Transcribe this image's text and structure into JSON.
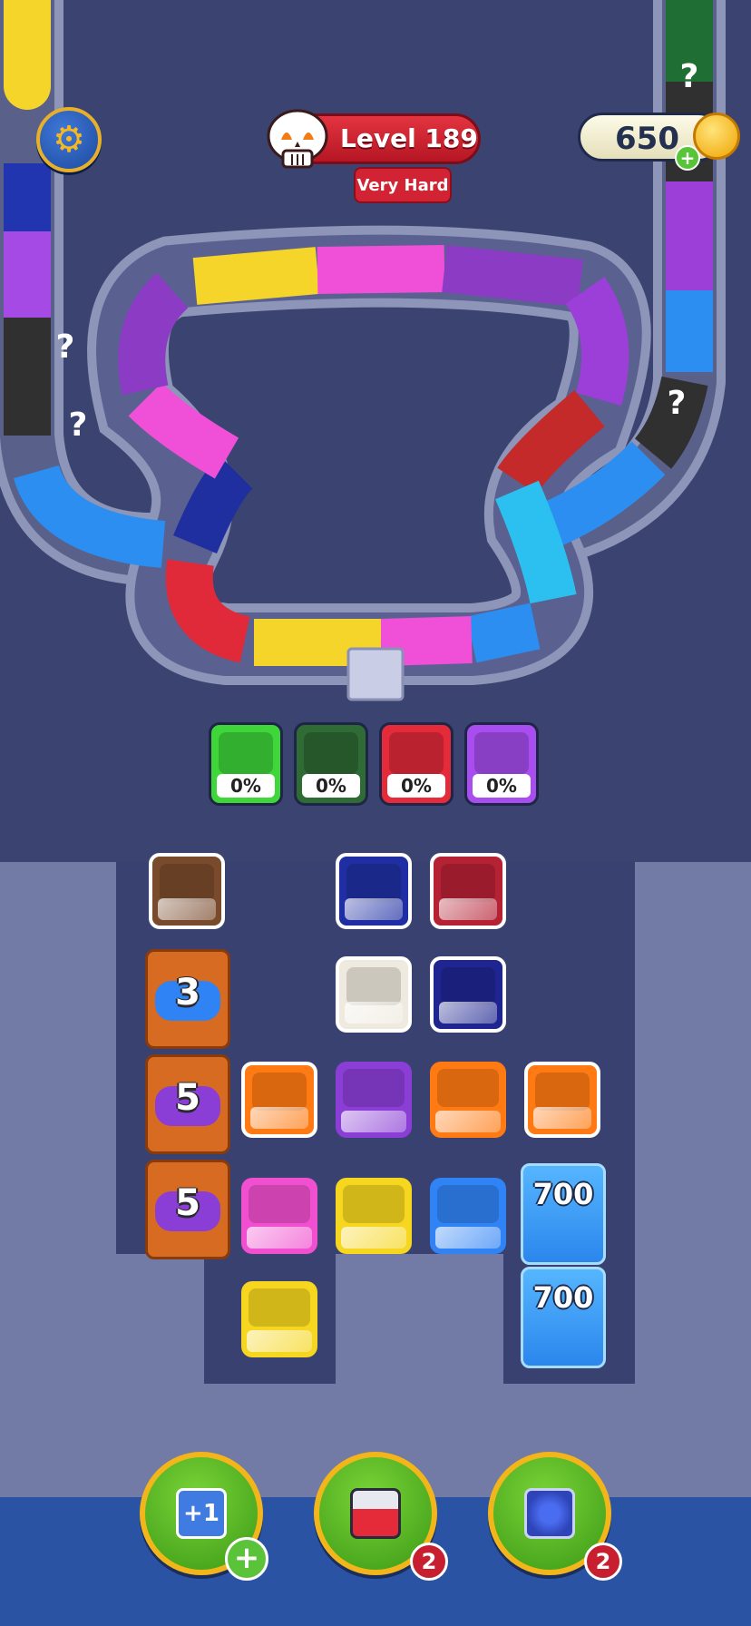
{
  "header": {
    "level_label": "Level 189",
    "difficulty": "Very Hard",
    "coins": "650"
  },
  "icons": {
    "settings": "gear-icon",
    "skull": "skull-icon",
    "coin": "coin-icon",
    "add_coins": "plus-icon"
  },
  "track": {
    "unknown_marker": "?"
  },
  "collectors": [
    {
      "color": "#3fd63a",
      "percent": "0%"
    },
    {
      "color": "#2f6b34",
      "percent": "0%"
    },
    {
      "color": "#e52a3a",
      "percent": "0%"
    },
    {
      "color": "#a84ef0",
      "percent": "0%"
    }
  ],
  "board": {
    "tiles": [
      {
        "color": "#7a4a2c",
        "outlined": true
      },
      {
        "color": "#1f2fa3",
        "outlined": true
      },
      {
        "color": "#b52234",
        "outlined": true
      },
      {
        "color": "#efeadf",
        "outlined": true
      },
      {
        "color": "#1e2590",
        "outlined": true
      },
      {
        "color": "#ff7a12",
        "outlined": true
      },
      {
        "color": "#8b3ed6",
        "outlined": false
      },
      {
        "color": "#ff7a12",
        "outlined": false
      },
      {
        "color": "#ff7a12",
        "outlined": true
      },
      {
        "color": "#f04fcf",
        "outlined": false
      },
      {
        "color": "#f6d61e",
        "outlined": false
      },
      {
        "color": "#2f83f5",
        "outlined": false
      },
      {
        "color": "#f6d61e",
        "outlined": false
      }
    ],
    "crates": [
      {
        "count": "3",
        "color": "#2f83f5"
      },
      {
        "count": "5",
        "color": "#8b3ed6"
      },
      {
        "count": "5",
        "color": "#8b3ed6"
      }
    ],
    "ice_blocks": [
      {
        "count": "700"
      },
      {
        "count": "700"
      }
    ]
  },
  "boosters": [
    {
      "name": "add-slot",
      "icon_label": "+1",
      "badge": "+"
    },
    {
      "name": "lift",
      "badge": "2"
    },
    {
      "name": "shuffle",
      "badge": "2"
    }
  ]
}
